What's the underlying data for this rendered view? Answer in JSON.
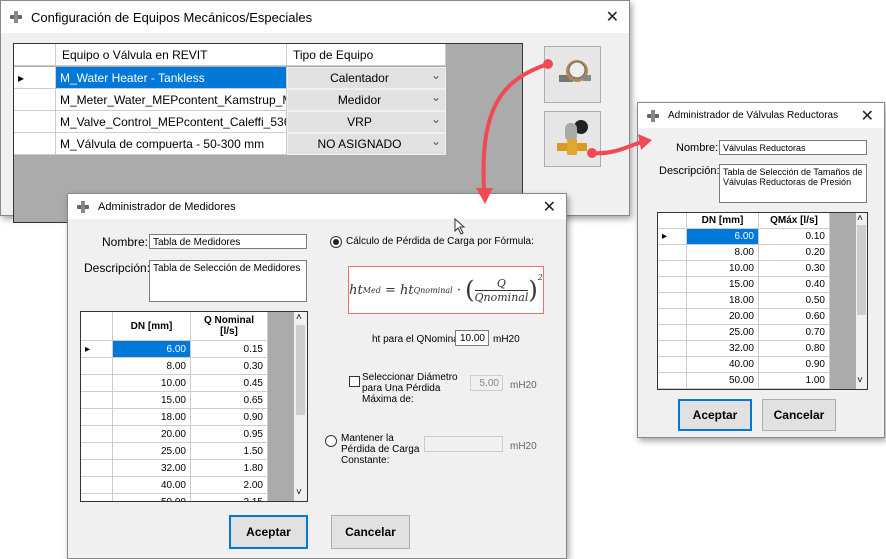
{
  "main_window": {
    "title": "Configuración de Equipos Mecánicos/Especiales",
    "columns": [
      "Equipo o Válvula en REVIT",
      "Tipo de Equipo"
    ],
    "rows": [
      {
        "name": "M_Water Heater - Tankless",
        "type": "Calentador",
        "selected": true
      },
      {
        "name": "M_Meter_Water_MEPcontent_Kamstrup_M...",
        "type": "Medidor"
      },
      {
        "name": "M_Valve_Control_MEPcontent_Caleffi_5360...",
        "type": "VRP"
      },
      {
        "name": "M_Válvula de compuerta - 50-300 mm",
        "type": "NO ASIGNADO"
      }
    ],
    "buttons": [
      {
        "icon": "water-meter-icon"
      },
      {
        "icon": "pressure-reducing-valve-icon"
      }
    ]
  },
  "medidores": {
    "title": "Administrador de Medidores",
    "nombre_label": "Nombre:",
    "nombre": "Tabla de Medidores",
    "descripcion_label": "Descripción:",
    "descripcion": "Tabla de Selección de Medidores",
    "columns": [
      "DN [mm]",
      "Q Nominal [l/s]"
    ],
    "rows": [
      [
        "6.00",
        "0.15"
      ],
      [
        "8.00",
        "0.30"
      ],
      [
        "10.00",
        "0.45"
      ],
      [
        "15.00",
        "0.65"
      ],
      [
        "18.00",
        "0.90"
      ],
      [
        "20.00",
        "0.95"
      ],
      [
        "25.00",
        "1.50"
      ],
      [
        "32.00",
        "1.80"
      ],
      [
        "40.00",
        "2.00"
      ],
      [
        "50.00",
        "2.15"
      ]
    ],
    "radio_formula": "Cálculo de Pérdida de Carga por Fórmula:",
    "radio_formula_checked": true,
    "ht_label": "ht para el QNominal:",
    "ht_value": "10.00",
    "unit": "mH20",
    "check_label": "Seleccionar Diámetro para Una Pérdida Máxima de:",
    "check_checked": false,
    "check_value": "5.00",
    "radio_const": "Mantener la Pérdida de Carga Constante:",
    "radio_const_checked": false,
    "const_value": "",
    "accept": "Aceptar",
    "cancel": "Cancelar"
  },
  "valvulas": {
    "title": "Administrador de Válvulas Reductoras",
    "nombre_label": "Nombre:",
    "nombre": "Válvulas Reductoras",
    "descripcion_label": "Descripción:",
    "descripcion": "Tabla de Selección de Tamaños de Válvulas Reductoras de Presión",
    "columns": [
      "DN [mm]",
      "QMáx [l/s]"
    ],
    "rows": [
      [
        "6.00",
        "0.10"
      ],
      [
        "8.00",
        "0.20"
      ],
      [
        "10.00",
        "0.30"
      ],
      [
        "15.00",
        "0.40"
      ],
      [
        "18.00",
        "0.50"
      ],
      [
        "20.00",
        "0.60"
      ],
      [
        "25.00",
        "0.70"
      ],
      [
        "32.00",
        "0.80"
      ],
      [
        "40.00",
        "0.90"
      ],
      [
        "50.00",
        "1.00"
      ]
    ],
    "accept": "Aceptar",
    "cancel": "Cancelar"
  },
  "colors": {
    "selection": "#0078d7",
    "arrow": "#f04b55",
    "formula_border": "#f07070"
  }
}
